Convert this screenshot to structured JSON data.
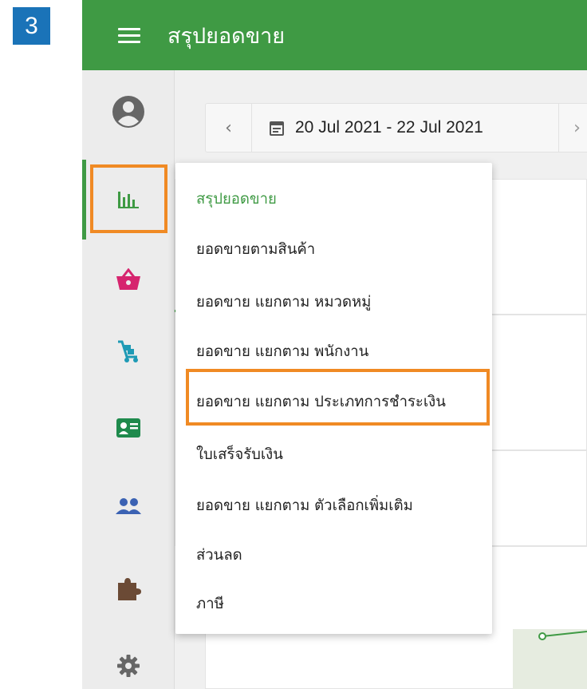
{
  "step_badge": "3",
  "header": {
    "title": "สรุปยอดขาย"
  },
  "date_filter": {
    "prev": "‹",
    "range": "20 Jul 2021 - 22 Jul 2021",
    "next": "›"
  },
  "sidebar": {
    "items": [
      {
        "name": "profile-icon"
      },
      {
        "name": "bar-chart-icon",
        "active": true
      },
      {
        "name": "basket-icon"
      },
      {
        "name": "cart-icon"
      },
      {
        "name": "id-card-icon"
      },
      {
        "name": "people-icon"
      },
      {
        "name": "puzzle-icon"
      },
      {
        "name": "gear-icon"
      }
    ]
  },
  "menu": {
    "items": [
      {
        "label": "สรุปยอดขาย",
        "active": true
      },
      {
        "label": "ยอดขายตามสินค้า"
      },
      {
        "label": "ยอดขาย แยกตาม หมวดหมู่"
      },
      {
        "label": "ยอดขาย แยกตาม พนักงาน"
      },
      {
        "label": "ยอดขาย แยกตาม ประเภทการชำระเงิน",
        "highlighted": true
      },
      {
        "label": "ใบเสร็จรับเงิน"
      },
      {
        "label": "ยอดขาย แยกตาม ตัวเลือกเพิ่มเติม"
      },
      {
        "label": "ส่วนลด"
      },
      {
        "label": "ภาษี"
      }
    ]
  },
  "colors": {
    "primary": "#3f9a44",
    "highlight": "#f08a24",
    "badge": "#1a73b8"
  }
}
